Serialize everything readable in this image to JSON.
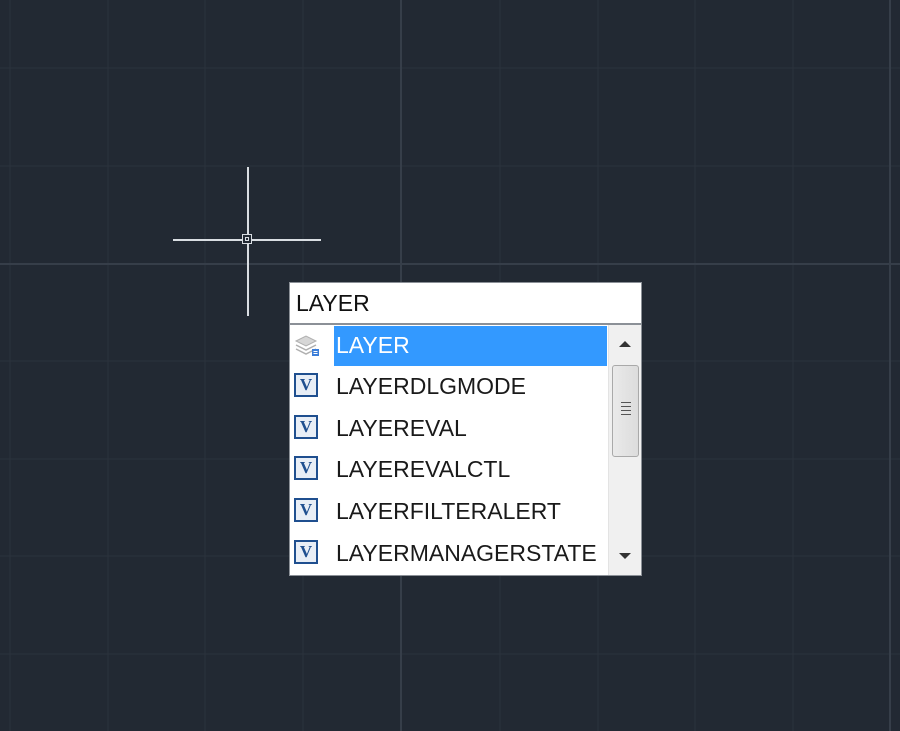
{
  "command_line": {
    "input_value": "LAYER"
  },
  "autocomplete": {
    "items": [
      {
        "label": "LAYER",
        "icon": "layers-icon",
        "selected": true
      },
      {
        "label": "LAYERDLGMODE",
        "icon": "system-variable-icon",
        "selected": false
      },
      {
        "label": "LAYEREVAL",
        "icon": "system-variable-icon",
        "selected": false
      },
      {
        "label": "LAYEREVALCTL",
        "icon": "system-variable-icon",
        "selected": false
      },
      {
        "label": "LAYERFILTERALERT",
        "icon": "system-variable-icon",
        "selected": false
      },
      {
        "label": "LAYERMANAGERSTATE",
        "icon": "system-variable-icon",
        "selected": false
      }
    ],
    "variable_icon_glyph": "V",
    "scroll_position": 0.2
  },
  "colors": {
    "canvas_background": "#222933",
    "selection": "#3399ff",
    "crosshair": "#d9dde2"
  }
}
